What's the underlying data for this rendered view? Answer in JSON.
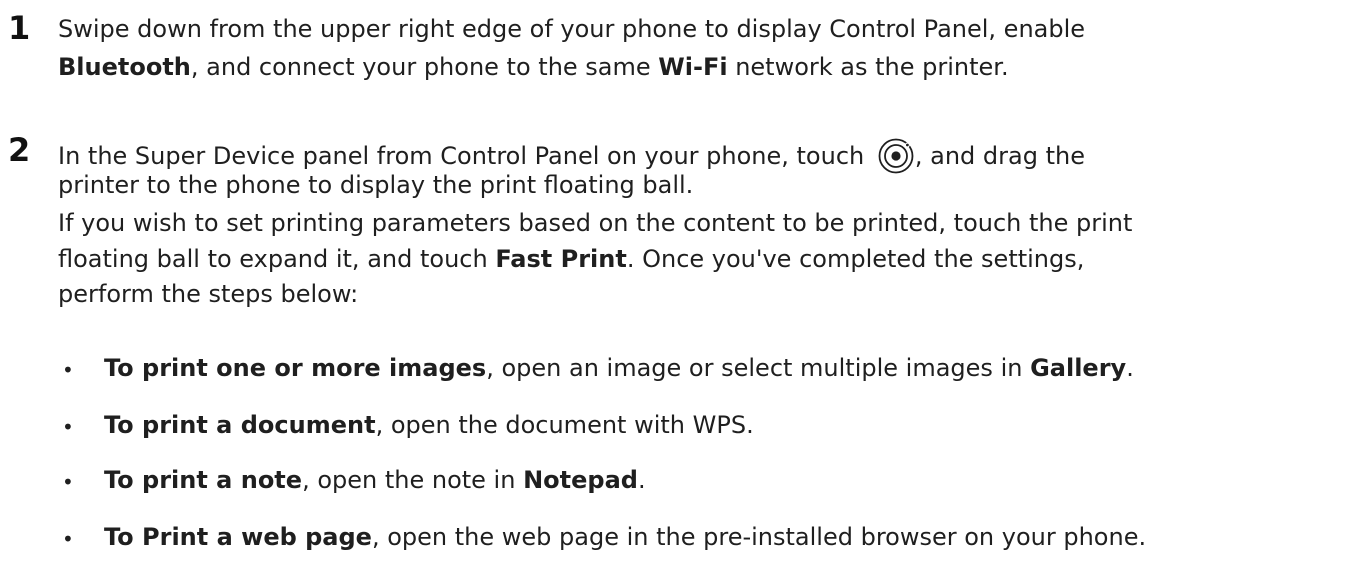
{
  "step1": {
    "number": "1",
    "l1": "Swipe down from the upper right edge of your phone to display Control Panel, enable",
    "l2_b1": "Bluetooth",
    "l2_t1": ", and connect your phone to the same ",
    "l2_b2": "Wi-Fi",
    "l2_t2": " network as the printer."
  },
  "step2": {
    "number": "2",
    "l1_t1": "In the Super Device panel from Control Panel on your phone, touch ",
    "icon": "super-device-icon",
    "l1_t2": ", and drag the",
    "l2": "printer to the phone to display the print floating ball.",
    "l3": "If you wish to set printing parameters based on the content to be printed, touch the print",
    "l4_t1": "floating ball to expand it, and touch ",
    "l4_b1": "Fast Print",
    "l4_t2": ". Once you've completed the settings,",
    "l5": "perform the steps below:"
  },
  "bullets": {
    "marker": "•",
    "b1_bold": "To print one or more images",
    "b1_t1": ", open an image or select multiple images in ",
    "b1_bold2": "Gallery",
    "b1_t2": ".",
    "b2_bold": "To print a document",
    "b2_t1": ", open the document with WPS.",
    "b3_bold": "To print a note",
    "b3_t1": ", open the note in ",
    "b3_bold2": "Notepad",
    "b3_t2": ".",
    "b4_bold": "To Print a web page",
    "b4_t1": ", open the web page in the pre-installed browser on your phone."
  }
}
